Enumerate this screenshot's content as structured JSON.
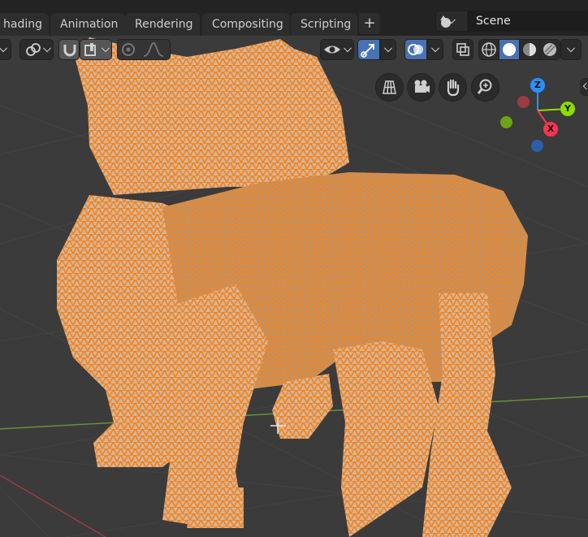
{
  "workspace_tabs": [
    {
      "label": "hading"
    },
    {
      "label": "Animation"
    },
    {
      "label": "Rendering"
    },
    {
      "label": "Compositing"
    },
    {
      "label": "Scripting"
    }
  ],
  "add_tab_label": "+",
  "scene": {
    "name": "Scene"
  },
  "gizmo": {
    "z_label": "Z",
    "y_label": "Y",
    "x_label": "X"
  },
  "colors": {
    "mesh_selected": "#ff7f0e",
    "grid_x_axis": "#9c3b43",
    "grid_y_axis": "#6b8d35",
    "active_button": "#4772b3",
    "gizmo_x": "#ff3352",
    "gizmo_y": "#8bdc00",
    "gizmo_z": "#2890ff"
  },
  "viewport": {
    "shading_modes": [
      "wireframe",
      "solid",
      "material-preview",
      "rendered"
    ],
    "active_shading": "solid"
  }
}
